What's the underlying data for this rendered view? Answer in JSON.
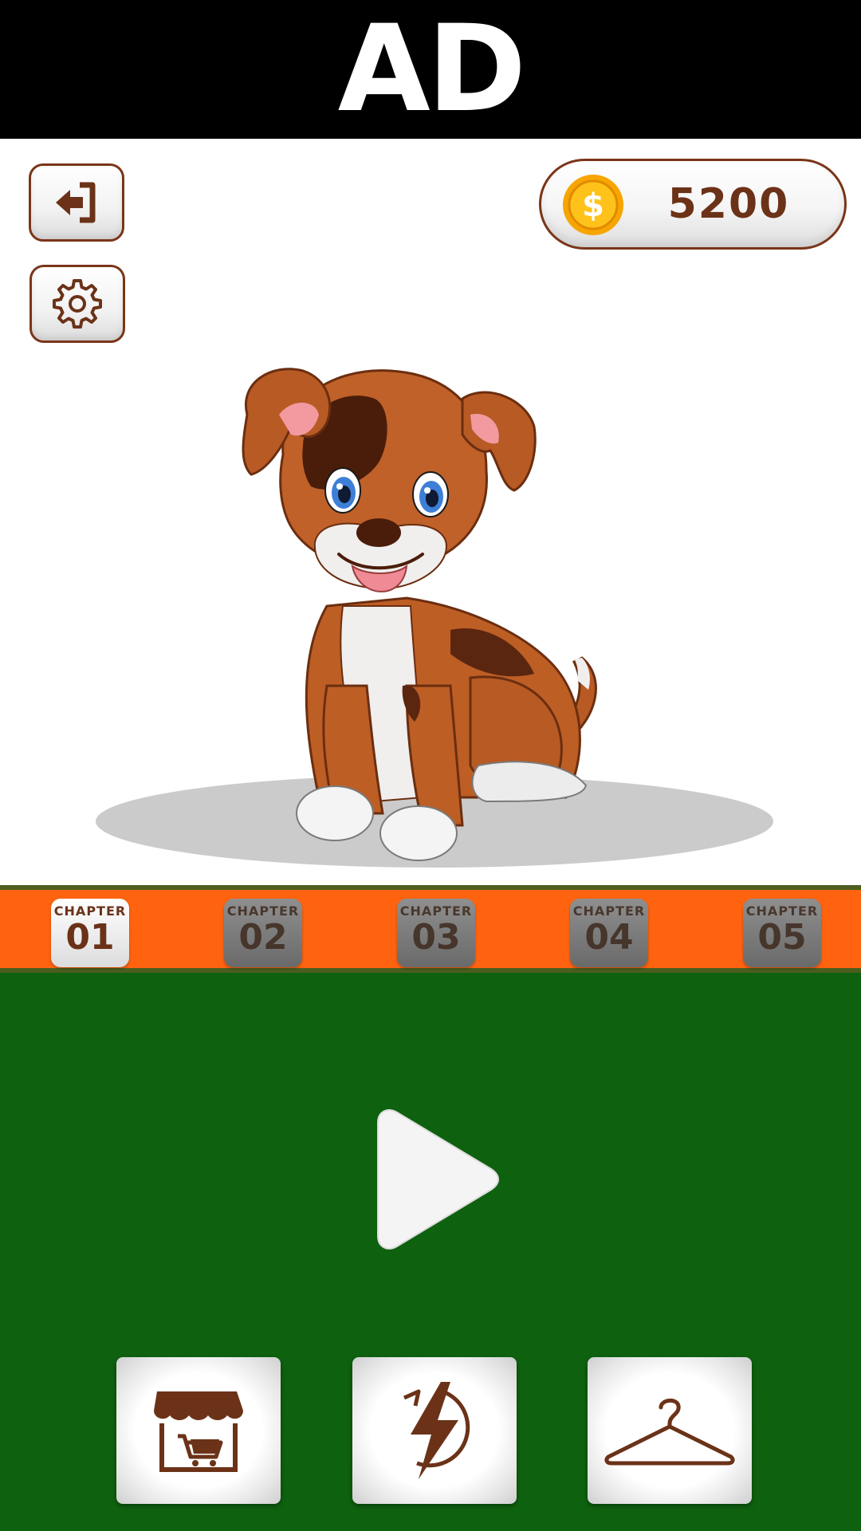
{
  "ad_banner": {
    "label": "AD"
  },
  "coins": {
    "value": "5200"
  },
  "chapters": [
    {
      "label": "CHAPTER",
      "number": "01",
      "state": "active"
    },
    {
      "label": "CHAPTER",
      "number": "02",
      "state": "locked"
    },
    {
      "label": "CHAPTER",
      "number": "03",
      "state": "locked"
    },
    {
      "label": "CHAPTER",
      "number": "04",
      "state": "locked"
    },
    {
      "label": "CHAPTER",
      "number": "05",
      "state": "locked"
    }
  ],
  "icons": {
    "exit": "exit-icon",
    "settings": "gear-icon",
    "coin": "coin-icon",
    "play": "play-icon",
    "shop": "shop-icon",
    "boost": "lightning-icon",
    "wardrobe": "hanger-icon"
  },
  "colors": {
    "brown": "#7a3518",
    "chapter_bar": "#ff630f",
    "green_area": "#0e610f",
    "ad_background": "#000000"
  }
}
